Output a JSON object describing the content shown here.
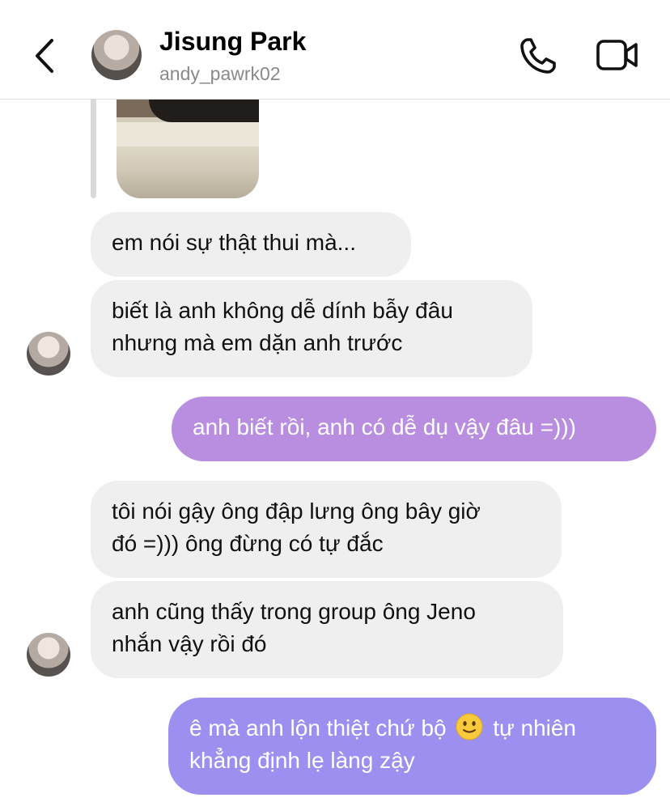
{
  "header": {
    "name": "Jisung Park",
    "username": "andy_pawrk02"
  },
  "messages": [
    {
      "dir": "in",
      "text": "em nói sự thật thui mà..."
    },
    {
      "dir": "in",
      "lines": [
        "biết là anh không dễ dính bẫy đâu",
        "nhưng mà em dặn anh trước"
      ]
    },
    {
      "dir": "out",
      "text": "anh biết rồi, anh có dễ dụ vậy đâu =)))",
      "color": "#b98ee0"
    },
    {
      "dir": "in",
      "lines": [
        "tôi nói gậy ông đập lưng ông bây giờ",
        "đó =))) ông đừng có tự đắc"
      ]
    },
    {
      "dir": "in",
      "lines": [
        "anh cũng thấy trong group ông Jeno",
        "nhắn vậy rồi đó"
      ]
    },
    {
      "dir": "out",
      "line1_before": "ê mà anh lộn thiệt chứ bộ",
      "emoji": "slightly-smiling-face",
      "line1_after": "tự nhiên",
      "line2": "khẳng định lẹ làng zậy",
      "color": "#9b8ff0"
    }
  ],
  "icons": {
    "back": "chevron-left-icon",
    "call": "phone-icon",
    "video": "video-camera-icon"
  },
  "colors": {
    "incoming_bubble": "#efefef",
    "outgoing_purple": "#b98ee0",
    "outgoing_violet": "#9b8ff0"
  }
}
